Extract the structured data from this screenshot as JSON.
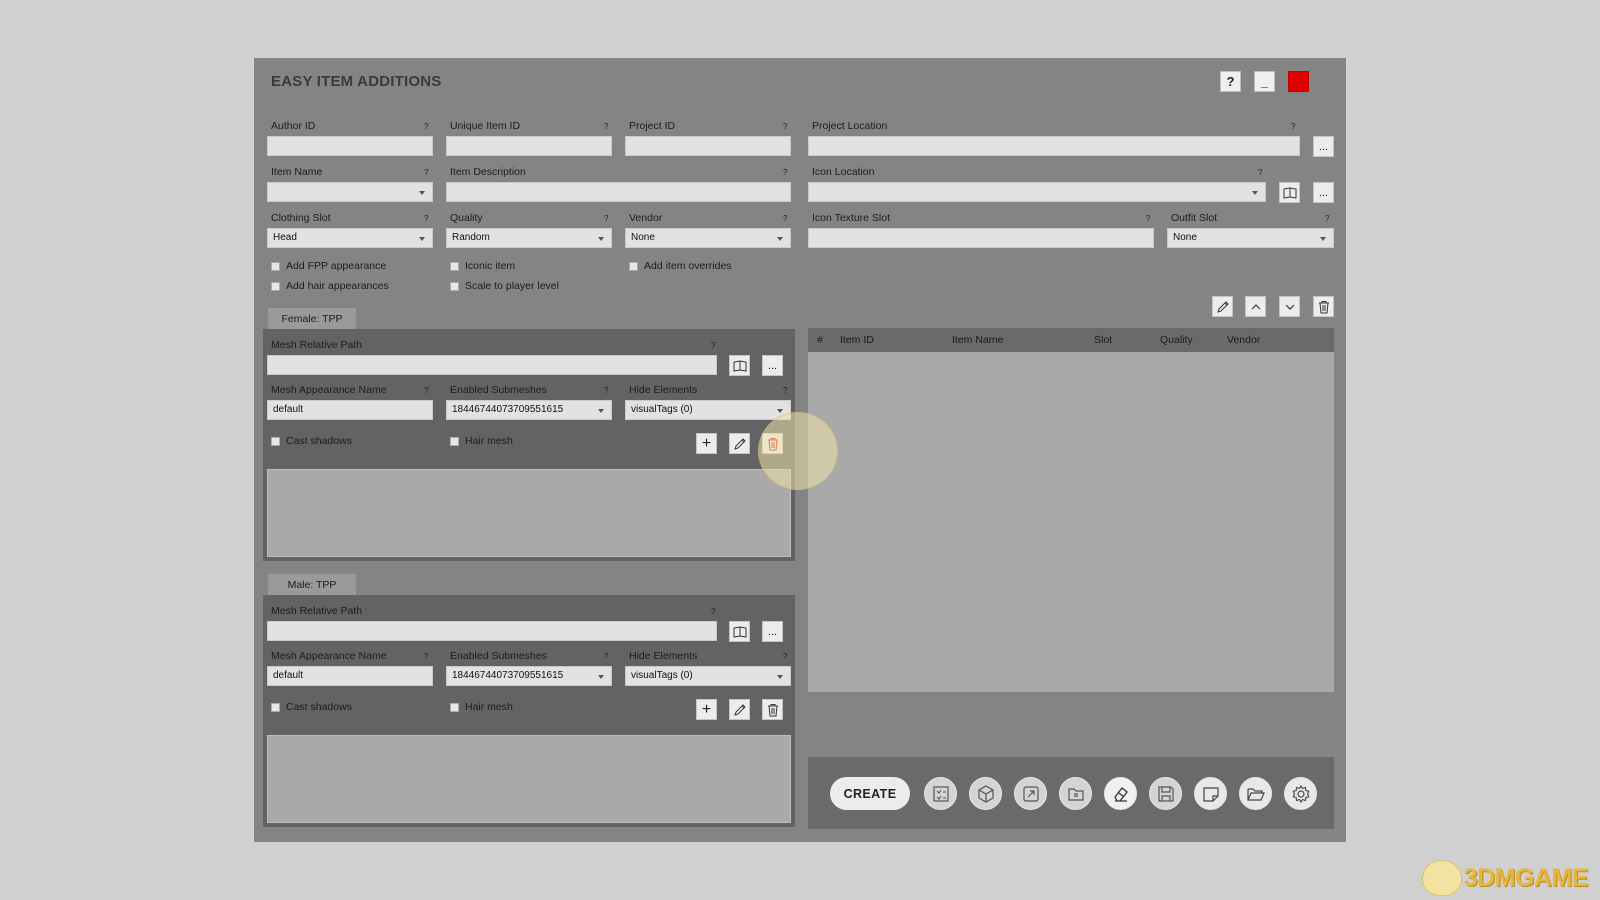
{
  "window": {
    "title": "EASY ITEM ADDITIONS",
    "help_label": "?",
    "minimize_label": "_",
    "close_color": "#e00000"
  },
  "form": {
    "q": "?",
    "author_id": {
      "label": "Author ID",
      "value": ""
    },
    "unique_item_id": {
      "label": "Unique Item ID",
      "value": ""
    },
    "project_id": {
      "label": "Project ID",
      "value": ""
    },
    "project_location": {
      "label": "Project Location",
      "value": "",
      "browse": "..."
    },
    "item_name": {
      "label": "Item Name",
      "value": ""
    },
    "item_description": {
      "label": "Item Description",
      "value": ""
    },
    "icon_location": {
      "label": "Icon Location",
      "value": "",
      "browse": "..."
    },
    "clothing_slot": {
      "label": "Clothing Slot",
      "value": "Head"
    },
    "quality": {
      "label": "Quality",
      "value": "Random"
    },
    "vendor": {
      "label": "Vendor",
      "value": "None"
    },
    "icon_texture_slot": {
      "label": "Icon Texture Slot",
      "value": ""
    },
    "outfit_slot": {
      "label": "Outfit Slot",
      "value": "None"
    },
    "checkboxes": {
      "add_fpp": "Add FPP appearance",
      "add_hair": "Add hair appearances",
      "iconic": "Iconic item",
      "scale": "Scale to player level",
      "overrides": "Add item overrides"
    }
  },
  "female": {
    "tab": "Female: TPP",
    "mesh_path_label": "Mesh Relative Path",
    "mesh_path_value": "",
    "browse": "...",
    "appearance_label": "Mesh Appearance Name",
    "appearance_value": "default",
    "submeshes_label": "Enabled Submeshes",
    "submeshes_value": "18446744073709551615",
    "hide_label": "Hide Elements",
    "hide_value": "visualTags (0)",
    "cast_shadows": "Cast shadows",
    "hair_mesh": "Hair mesh",
    "add_label": "+"
  },
  "male": {
    "tab": "Male: TPP",
    "mesh_path_label": "Mesh Relative Path",
    "mesh_path_value": "",
    "browse": "...",
    "appearance_label": "Mesh Appearance Name",
    "appearance_value": "default",
    "submeshes_label": "Enabled Submeshes",
    "submeshes_value": "18446744073709551615",
    "hide_label": "Hide Elements",
    "hide_value": "visualTags (0)",
    "cast_shadows": "Cast shadows",
    "hair_mesh": "Hair mesh",
    "add_label": "+"
  },
  "table": {
    "columns": [
      "#",
      "Item ID",
      "Item Name",
      "Slot",
      "Quality",
      "Vendor"
    ],
    "rows": []
  },
  "bottom": {
    "create_label": "CREATE",
    "icons": [
      "checklist-icon",
      "cube-icon",
      "export-icon",
      "folder-tab-icon",
      "eraser-icon",
      "save-icon",
      "new-file-icon",
      "open-folder-icon",
      "settings-icon"
    ]
  },
  "watermark": {
    "text": "3DMGAME"
  }
}
